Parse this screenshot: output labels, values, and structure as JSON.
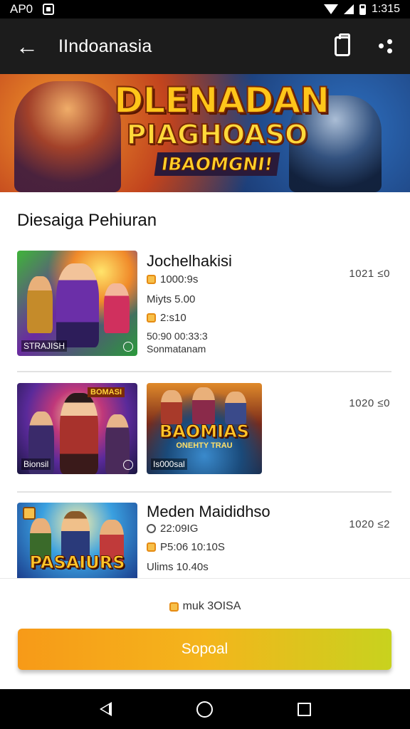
{
  "status_bar": {
    "carrier": "AP0",
    "time": "1:315"
  },
  "app_bar": {
    "title": "IIndoanasia",
    "icons": [
      "back-arrow-icon",
      "clipboard-icon",
      "share-icon"
    ]
  },
  "banner": {
    "line1": "DLENADAN",
    "line2": "PIAGHOASO",
    "line3": "IBAOMGNI!"
  },
  "section": {
    "title": "Diesaiga Pehiuran"
  },
  "rows": [
    {
      "title": "Jochelhakisi",
      "thumb_label": "STRAJISH",
      "lines": [
        "1000:9s",
        "Miyts 5.00",
        "2:s10",
        "50:90 00:33:3",
        "Sonmatanam"
      ],
      "meta": "1021 ≤0"
    },
    {
      "title": "",
      "thumb_label": "Bionsil",
      "thumb_tag": "BOMASI",
      "thumb2_label": "Is000sal",
      "thumb2_title": "BAOMIAS",
      "thumb2_sub": "ONEHTY TRAU",
      "meta": "1020 ≤0"
    },
    {
      "title": "Meden Maididhso",
      "thumb_title": "PASAIURS",
      "lines": [
        "22:09IG",
        "P5:06 10:10S",
        "Ulims 10.40s"
      ],
      "meta": "1020 ≤2"
    }
  ],
  "footer": {
    "note": "muk 3OISA",
    "cta": "Sopoal"
  },
  "colors": {
    "accent": "#f79a18",
    "cta_end": "#c8d21e",
    "app_bar": "#1c1c1c"
  }
}
